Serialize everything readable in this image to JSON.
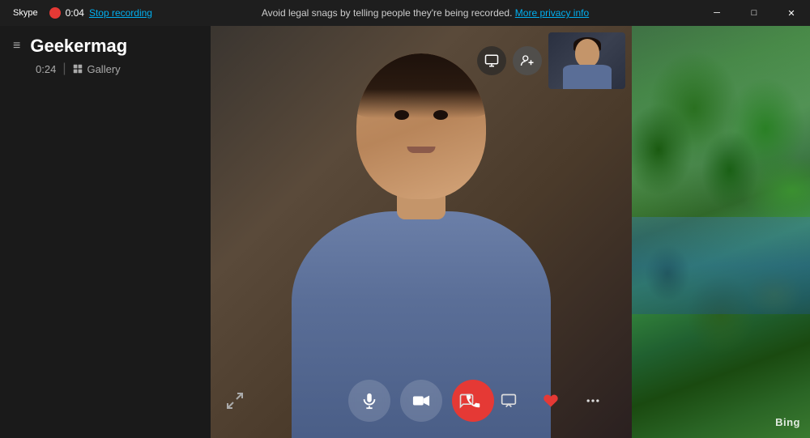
{
  "titlebar": {
    "app_name": "Skype",
    "record_time": "0:04",
    "stop_recording_label": "Stop recording",
    "notice_text": "Avoid legal snags by telling people they're being recorded.",
    "privacy_link_label": "More privacy info",
    "minimize_label": "─",
    "maximize_label": "□",
    "close_label": "✕"
  },
  "sidebar": {
    "menu_icon": "≡",
    "contact_name": "Geekermag",
    "call_duration": "0:24",
    "separator": "|",
    "gallery_label": "Gallery"
  },
  "video_controls": {
    "mute_icon": "mic",
    "video_icon": "video",
    "end_call_icon": "phone",
    "chat_icon": "chat",
    "screen_share_icon": "screen",
    "react_icon": "heart",
    "more_icon": "...",
    "expand_icon": "expand"
  },
  "bing": {
    "logo": "Bing"
  }
}
